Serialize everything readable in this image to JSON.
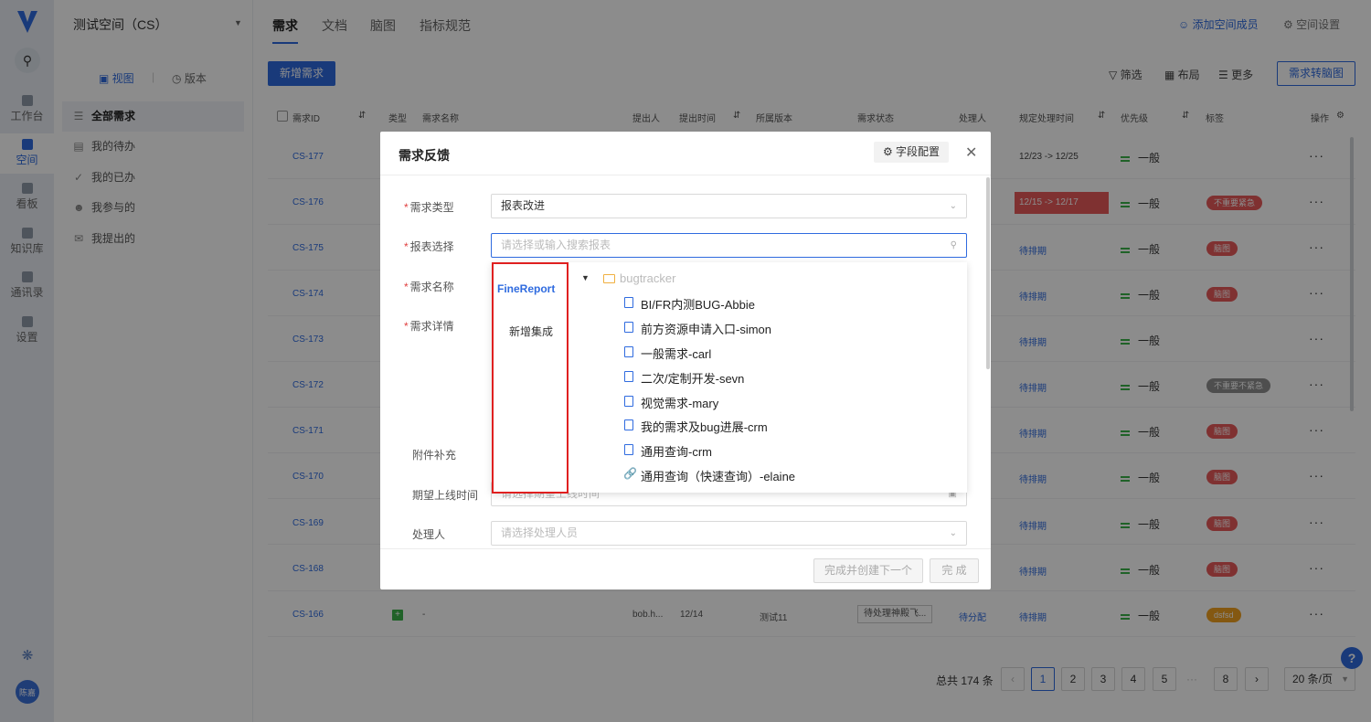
{
  "nav": {
    "items": [
      {
        "label": "工作台",
        "icon": "workbench-icon"
      },
      {
        "label": "空间",
        "icon": "space-icon"
      },
      {
        "label": "看板",
        "icon": "board-icon"
      },
      {
        "label": "知识库",
        "icon": "knowledge-icon"
      },
      {
        "label": "通讯录",
        "icon": "contacts-icon"
      },
      {
        "label": "设置",
        "icon": "settings-icon"
      }
    ],
    "avatar": "陈嘉"
  },
  "sidebar": {
    "space_name": "测试空间（CS）",
    "tab_view": "视图",
    "tab_version": "版本",
    "items": [
      "全部需求",
      "我的待办",
      "我的已办",
      "我参与的",
      "我提出的"
    ]
  },
  "header": {
    "tabs": [
      "需求",
      "文档",
      "脑图",
      "指标规范"
    ],
    "add_member": "添加空间成员",
    "space_settings": "空间设置"
  },
  "toolbar": {
    "new_req": "新增需求",
    "filter": "筛选",
    "layout": "布局",
    "more": "更多",
    "to_mindmap": "需求转脑图"
  },
  "table": {
    "headers": [
      "需求ID",
      "类型",
      "需求名称",
      "提出人",
      "提出时间",
      "所属版本",
      "需求状态",
      "处理人",
      "规定处理时间",
      "优先级",
      "标签",
      "操作"
    ],
    "rows": [
      {
        "id": "CS-177",
        "date": "12/23 -> 12/25",
        "status": "",
        "prio": "一般",
        "tag": ""
      },
      {
        "id": "CS-176",
        "date": "12/15 -> 12/17",
        "status": "",
        "prio": "一般",
        "tag": "不重要紧急"
      },
      {
        "id": "CS-175",
        "date": "",
        "status": "待排期",
        "prio": "一般",
        "tag": "脑图"
      },
      {
        "id": "CS-174",
        "date": "",
        "status": "待排期",
        "prio": "一般",
        "tag": "脑图"
      },
      {
        "id": "CS-173",
        "date": "",
        "status": "待排期",
        "prio": "一般",
        "tag": ""
      },
      {
        "id": "CS-172",
        "date": "",
        "status": "待排期",
        "prio": "一般",
        "tag": "不重要不紧急"
      },
      {
        "id": "CS-171",
        "date": "",
        "status": "待排期",
        "prio": "一般",
        "tag": "脑图"
      },
      {
        "id": "CS-170",
        "date": "",
        "status": "待排期",
        "prio": "一般",
        "tag": "脑图"
      },
      {
        "id": "CS-169",
        "date": "",
        "status": "待排期",
        "prio": "一般",
        "tag": "脑图"
      },
      {
        "id": "CS-168",
        "date": "",
        "status": "待排期",
        "prio": "一般",
        "tag": "脑图"
      },
      {
        "id": "CS-166",
        "name": "-",
        "proposer": "bob.h...",
        "ptime": "12/14",
        "version": "测试11",
        "state": "待处理神殿飞...",
        "handler": "待分配",
        "status": "待排期",
        "prio": "一般",
        "tag": "dsfsd"
      }
    ]
  },
  "pagination": {
    "total": "总共 174 条",
    "pages": [
      "1",
      "2",
      "3",
      "4",
      "5",
      "···",
      "8"
    ],
    "page_size": "20 条/页",
    "help": "?"
  },
  "modal": {
    "title": "需求反馈",
    "field_config": "字段配置",
    "fields": {
      "type_label": "需求类型",
      "type_value": "报表改进",
      "report_label": "报表选择",
      "report_placeholder": "请选择或输入搜索报表",
      "name_label": "需求名称",
      "detail_label": "需求详情",
      "attach_label": "附件补充",
      "online_label": "期望上线时间",
      "online_placeholder": "请选择期望上线时间",
      "handler_label": "处理人",
      "handler_placeholder": "请选择处理人员"
    },
    "btn_next": "完成并创建下一个",
    "btn_done": "完 成"
  },
  "dropdown": {
    "left": [
      "FineReport",
      "新增集成"
    ],
    "folder": "bugtracker",
    "items": [
      {
        "label": "BI/FR内测BUG-Abbie",
        "icon": "report-file-icon"
      },
      {
        "label": "前方资源申请入口-simon",
        "icon": "report-file-icon"
      },
      {
        "label": "一般需求-carl",
        "icon": "report-file-icon"
      },
      {
        "label": "二次/定制开发-sevn",
        "icon": "report-file-icon"
      },
      {
        "label": "视觉需求-mary",
        "icon": "report-file-icon"
      },
      {
        "label": "我的需求及bug进展-crm",
        "icon": "report-file-icon"
      },
      {
        "label": "通用查询-crm",
        "icon": "report-file-icon"
      },
      {
        "label": "通用查询（快速查询）-elaine",
        "icon": "link-icon"
      }
    ]
  }
}
